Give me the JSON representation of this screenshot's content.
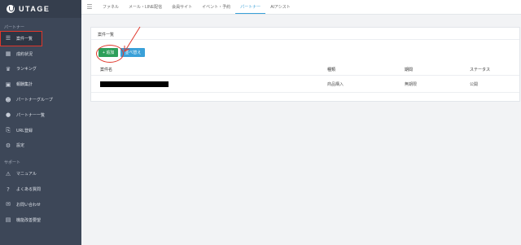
{
  "app": {
    "logo_text": "UTAGE"
  },
  "sidebar": {
    "section_partner": "パートナー",
    "items": [
      {
        "label": "案件一覧",
        "icon": "list-icon"
      },
      {
        "label": "成約状況",
        "icon": "chart-icon"
      },
      {
        "label": "ランキング",
        "icon": "crown-icon"
      },
      {
        "label": "報酬集計",
        "icon": "wallet-icon"
      },
      {
        "label": "パートナーグループ",
        "icon": "group-icon"
      },
      {
        "label": "パートナー一覧",
        "icon": "user-icon"
      },
      {
        "label": "URL登録",
        "icon": "link-icon"
      },
      {
        "label": "設定",
        "icon": "gear-icon"
      }
    ],
    "section_support": "サポート",
    "support_items": [
      {
        "label": "マニュアル",
        "icon": "manual-icon"
      },
      {
        "label": "よくある質問",
        "icon": "question-icon"
      },
      {
        "label": "お問い合わせ",
        "icon": "mail-icon"
      },
      {
        "label": "機能改善要望",
        "icon": "note-icon"
      }
    ]
  },
  "topnav": {
    "tabs": [
      {
        "label": "ファネル"
      },
      {
        "label": "メール・LINE配信"
      },
      {
        "label": "会員サイト"
      },
      {
        "label": "イベント・予約"
      },
      {
        "label": "パートナー"
      },
      {
        "label": "AIアシスト"
      }
    ],
    "active_tab": "パートナー"
  },
  "card": {
    "title": "案件一覧",
    "add_button": "+ 追加",
    "sort_button": "並べ替え",
    "columns": [
      "案件名",
      "種類",
      "期間",
      "ステータス"
    ],
    "rows": [
      {
        "name": "",
        "type": "商品購入",
        "period": "無期限",
        "status": "公開"
      }
    ]
  },
  "colors": {
    "sidebar_bg": "#3d4758",
    "accent": "#3aa0d8",
    "add_green": "#2e9f5a",
    "annotation_red": "#e0372b"
  }
}
